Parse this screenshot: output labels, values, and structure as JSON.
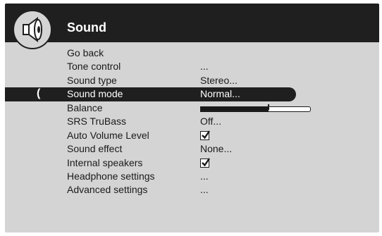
{
  "header": {
    "title": "Sound",
    "icon": "speaker-icon"
  },
  "menu": {
    "rows": [
      {
        "label": "Go back",
        "value": "",
        "kind": "text"
      },
      {
        "label": "Tone control",
        "value": "...",
        "kind": "text"
      },
      {
        "label": "Sound type",
        "value": "Stereo...",
        "kind": "text"
      },
      {
        "label": "Sound mode",
        "value": "Normal...",
        "kind": "text",
        "selected": true
      },
      {
        "label": "Balance",
        "value": "",
        "kind": "balance",
        "level": 0.62
      },
      {
        "label": "SRS TruBass",
        "value": "Off...",
        "kind": "text"
      },
      {
        "label": "Auto Volume Level",
        "value": "",
        "kind": "checkbox",
        "checked": true
      },
      {
        "label": "Sound effect",
        "value": "None...",
        "kind": "text"
      },
      {
        "label": "Internal speakers",
        "value": "",
        "kind": "checkbox",
        "checked": true
      },
      {
        "label": "Headphone settings",
        "value": "...",
        "kind": "text"
      },
      {
        "label": "Advanced settings",
        "value": "...",
        "kind": "text"
      }
    ],
    "selected_marker": "("
  },
  "colors": {
    "panel": "#d4d4d4",
    "header": "#1f1f1f",
    "selection": "#1f1f1f",
    "text": "#1a1a1a"
  }
}
